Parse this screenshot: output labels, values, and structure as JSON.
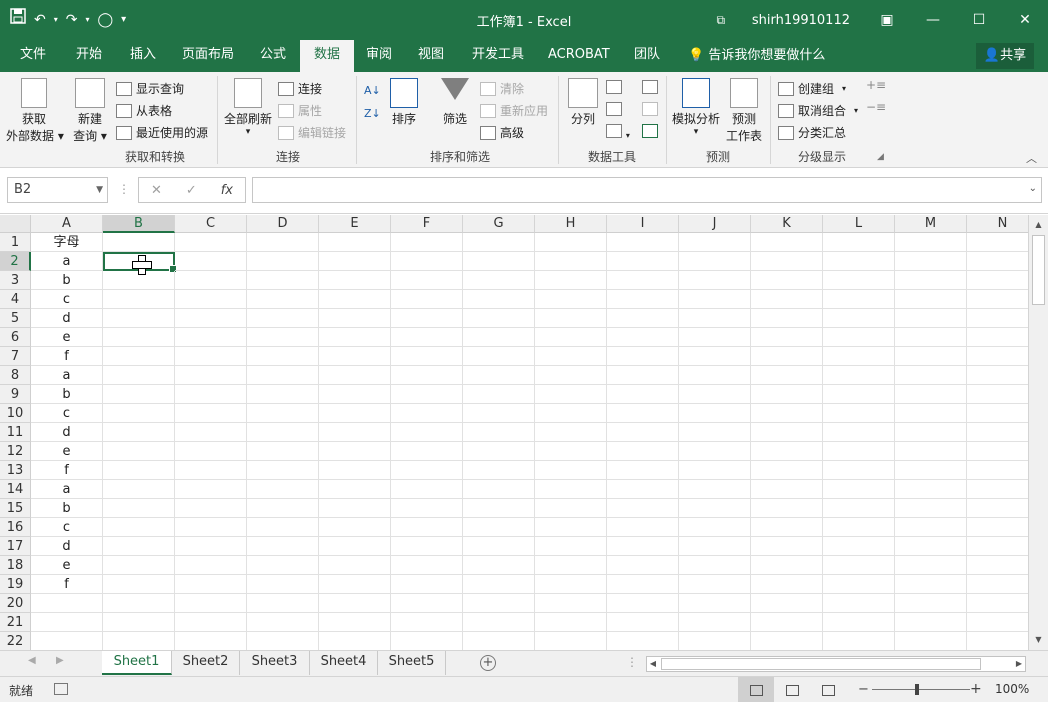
{
  "window": {
    "title": "工作簿1 - Excel",
    "user": "shirh19910112",
    "accent": "#217346"
  },
  "qat": {
    "save_icon": "save-icon",
    "undo_icon": "undo-icon",
    "redo_icon": "redo-icon",
    "circle_icon": "circle-icon",
    "customize_icon": "customize-icon"
  },
  "tabs": [
    "文件",
    "开始",
    "插入",
    "页面布局",
    "公式",
    "数据",
    "审阅",
    "视图",
    "开发工具",
    "ACROBAT",
    "团队"
  ],
  "active_tab": "数据",
  "tell_me": "告诉我你想要做什么",
  "share": "共享",
  "ribbon": {
    "get_external": "获取\n外部数据",
    "get_external_l1": "获取",
    "get_external_l2": "外部数据",
    "new_query_l1": "新建",
    "new_query_l2": "查询",
    "show_queries": "显示查询",
    "from_table": "从表格",
    "recent_sources": "最近使用的源",
    "group_get_transform": "获取和转换",
    "refresh_all": "全部刷新",
    "connections": "连接",
    "properties": "属性",
    "edit_links": "编辑链接",
    "group_connections": "连接",
    "sort": "排序",
    "filter": "筛选",
    "clear": "清除",
    "reapply": "重新应用",
    "advanced": "高级",
    "group_sort_filter": "排序和筛选",
    "text_to_columns": "分列",
    "group_data_tools": "数据工具",
    "what_if": "模拟分析",
    "forecast_l1": "预测",
    "forecast_l2": "工作表",
    "group_forecast": "预测",
    "group": "创建组",
    "ungroup": "取消组合",
    "subtotal": "分类汇总",
    "group_outline": "分级显示"
  },
  "formula_bar": {
    "name_box": "B2",
    "cancel": "✕",
    "enter": "✓",
    "fx": "fx",
    "value": ""
  },
  "grid": {
    "columns": [
      "A",
      "B",
      "C",
      "D",
      "E",
      "F",
      "G",
      "H",
      "I",
      "J",
      "K",
      "L",
      "M",
      "N"
    ],
    "rows": [
      "1",
      "2",
      "3",
      "4",
      "5",
      "6",
      "7",
      "8",
      "9",
      "10",
      "11",
      "12",
      "13",
      "14",
      "15",
      "16",
      "17",
      "18",
      "19",
      "20",
      "21",
      "22"
    ],
    "colA": [
      "字母",
      "a",
      "b",
      "c",
      "d",
      "e",
      "f",
      "a",
      "b",
      "c",
      "d",
      "e",
      "f",
      "a",
      "b",
      "c",
      "d",
      "e",
      "f",
      "",
      "",
      ""
    ],
    "active_cell": "B2",
    "selected_column": "B",
    "selected_row": "2"
  },
  "sheets": [
    "Sheet1",
    "Sheet2",
    "Sheet3",
    "Sheet4",
    "Sheet5"
  ],
  "active_sheet": "Sheet1",
  "status": {
    "ready": "就绪",
    "zoom": "100%",
    "zoom_level": 100
  }
}
